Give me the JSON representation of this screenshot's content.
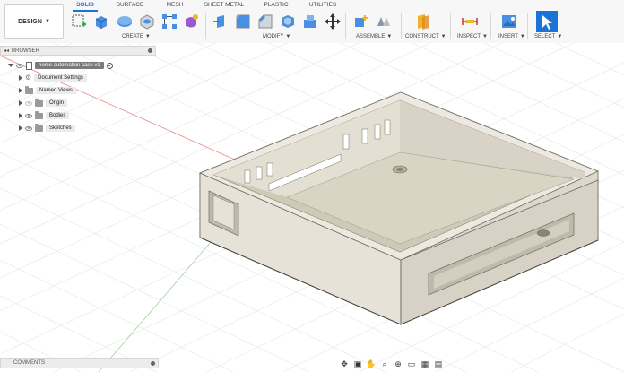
{
  "toolbar": {
    "workspace_label": "DESIGN",
    "tabs": [
      "SOLID",
      "SURFACE",
      "MESH",
      "SHEET METAL",
      "PLASTIC",
      "UTILITIES"
    ],
    "active_tab": "SOLID",
    "groups": {
      "create": "CREATE",
      "modify": "MODIFY",
      "assemble": "ASSEMBLE",
      "construct": "CONSTRUCT",
      "inspect": "INSPECT",
      "insert": "INSERT",
      "select": "SELECT"
    },
    "accent_color": "#1a74d8"
  },
  "browser": {
    "title": "BROWSER",
    "root": "home automation case v1",
    "items": [
      {
        "label": "Document Settings",
        "icon": "gear-icon"
      },
      {
        "label": "Named Views",
        "icon": "folder-icon"
      },
      {
        "label": "Origin",
        "icon": "folder-icon",
        "visibility": true
      },
      {
        "label": "Bodies",
        "icon": "folder-icon",
        "visibility": true
      },
      {
        "label": "Sketches",
        "icon": "folder-icon",
        "visibility": true
      }
    ]
  },
  "comments": {
    "title": "COMMENTS"
  },
  "navbar": {
    "icons": [
      "orbit-icon",
      "look-at-icon",
      "pan-icon",
      "zoom-icon",
      "fit-icon",
      "display-settings-icon",
      "grid-icon",
      "viewports-icon"
    ]
  }
}
